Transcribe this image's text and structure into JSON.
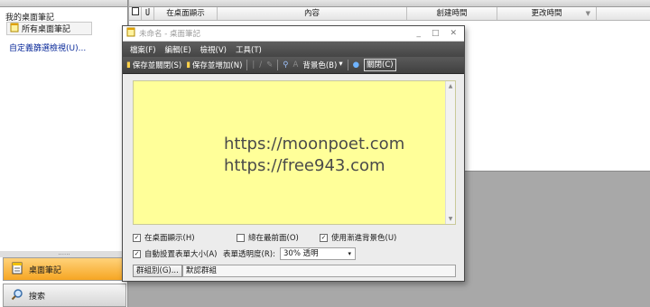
{
  "left_panel": {
    "header": "",
    "tree_root": "我的桌面筆記",
    "selected_item": "所有桌面筆記",
    "custom_view_link": "自定義篩選檢視(U)...",
    "grip": "......",
    "nav": [
      {
        "label": "桌面筆記",
        "icon": "sticky-note-icon"
      },
      {
        "label": "搜索",
        "icon": "magnifier-icon"
      }
    ]
  },
  "right_panel": {
    "header": "",
    "columns": [
      "在桌面顯示",
      "內容",
      "創建時間",
      "更改時間"
    ]
  },
  "note_window": {
    "title": "未命名 - 桌面筆記",
    "menu": [
      "檔案(F)",
      "編輯(E)",
      "檢視(V)",
      "工具(T)"
    ],
    "toolbar": {
      "save_close": "保存並關閉(S)",
      "save_add": "保存並增加(N)",
      "bg_color": "背景色(B)",
      "close": "關閉(C)"
    },
    "content_lines": [
      "https://moonpoet.com",
      "https://free943.com"
    ],
    "options": {
      "show_on_desktop": "在桌面顯示(H)",
      "always_on_top": "總在最前面(O)",
      "gradient_bg": "使用漸進背景色(U)",
      "auto_size": "自動設置表單大小(A)",
      "opacity_label": "表單透明度(R):",
      "opacity_value": "30% 透明"
    },
    "group_button": "群組別(G)...",
    "group_value": "默認群組"
  },
  "colors": {
    "note_bg": "#ffff99",
    "nav_active": "#f6a623",
    "toolbar_bg": "#454545"
  }
}
